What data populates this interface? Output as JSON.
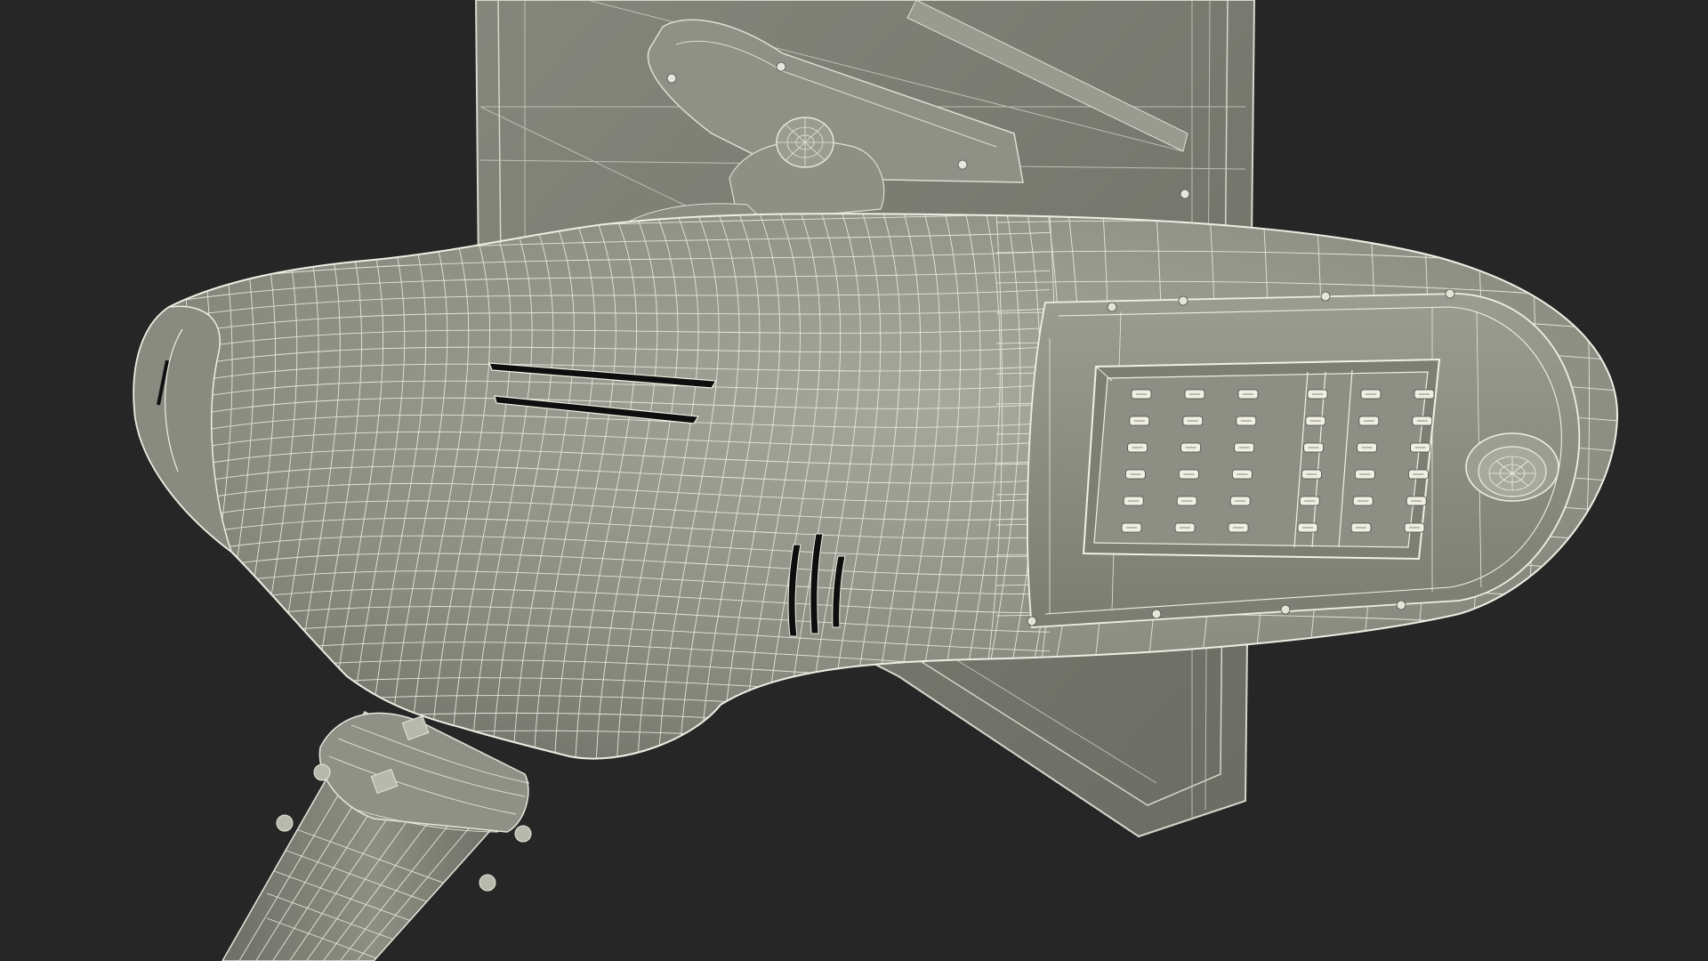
{
  "scene": {
    "subject": "street-lamp-wireframe-render",
    "colors": {
      "background": "#262626",
      "surface": "#8a8b80",
      "surface_light": "#a4a59a",
      "surface_dark": "#5f6058",
      "wire": "#e6e7db",
      "led": "#efefe4",
      "slot": "#0e0e0e"
    },
    "led_grid": {
      "rows": 6,
      "columns": 6
    }
  }
}
